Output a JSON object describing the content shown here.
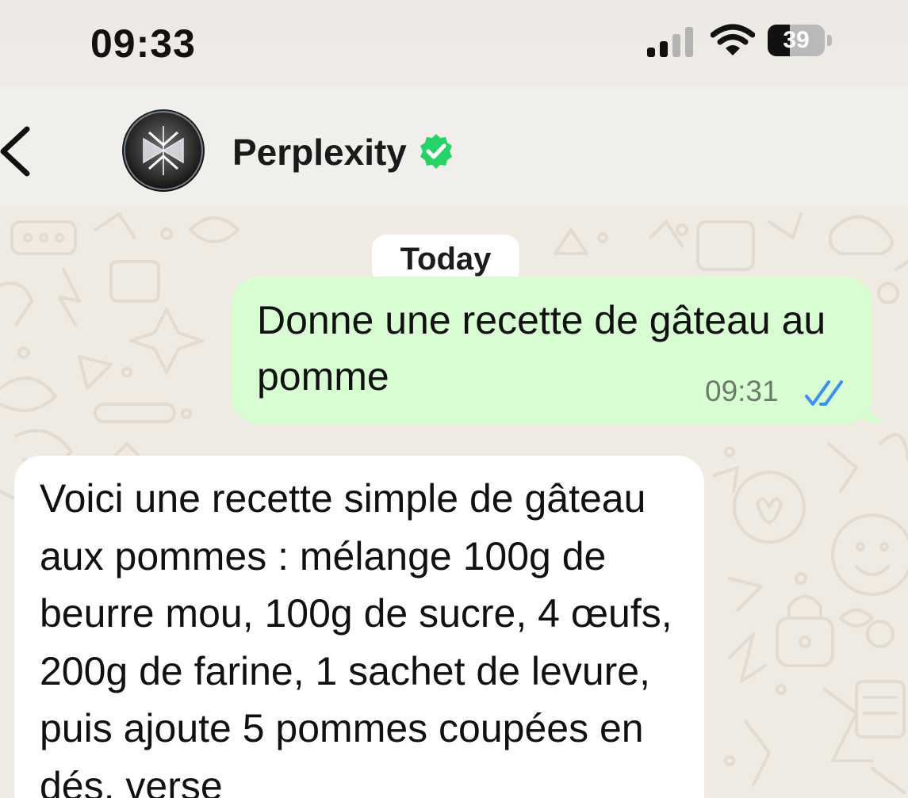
{
  "status_bar": {
    "time": "09:33",
    "battery_level": "39",
    "battery_fraction": 0.39,
    "signal_bars_active": 2,
    "signal_bars_total": 4
  },
  "header": {
    "back_icon": "chevron-left-icon",
    "contact_name": "Perplexity",
    "verified_icon": "verified-badge-icon",
    "verified_color": "#25d366"
  },
  "chat": {
    "date_chip": "Today",
    "messages": [
      {
        "direction": "outgoing",
        "text": "Donne une recette de gâteau au pomme",
        "time": "09:31",
        "status_icon": "double-check-read-icon",
        "bubble_color": "#d9fdd3",
        "status_color": "#3a8ef6"
      },
      {
        "direction": "incoming",
        "text": "Voici une recette simple de gâteau aux pommes : mélange 100g de beurre mou, 100g de sucre, 4 œufs, 200g de farine, 1 sachet de levure, puis ajoute 5 pommes coupées en dés, verse",
        "bubble_color": "#ffffff"
      }
    ]
  },
  "colors": {
    "wallpaper": "#efeae2",
    "header_bg": "#f1efeb"
  }
}
